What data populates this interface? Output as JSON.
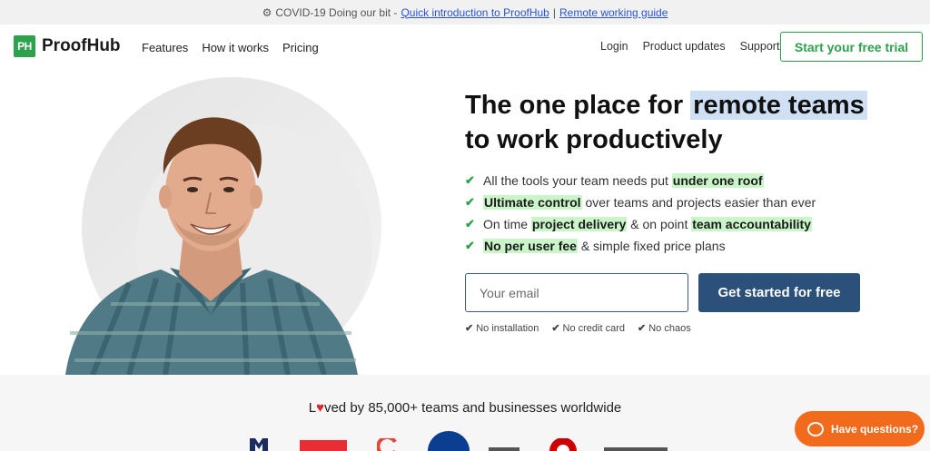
{
  "topbar": {
    "prefix": "COVID-19 Doing our bit -",
    "link1": "Quick introduction to ProofHub",
    "separator": "|",
    "link2": "Remote working guide"
  },
  "nav": {
    "logo_badge": "PH",
    "logo_text": "ProofHub",
    "left_items": [
      "Features",
      "How it works",
      "Pricing"
    ],
    "right_items": [
      "Login",
      "Product updates",
      "Support"
    ],
    "cta": "Start your free trial"
  },
  "hero": {
    "headline_part1": "The one place for",
    "headline_highlight": "remote teams",
    "headline_part2": "to work productively",
    "features": [
      {
        "before": "All the tools your team needs put ",
        "highlight": "under one roof",
        "after": ""
      },
      {
        "before": "",
        "highlight": "Ultimate control",
        "after": " over teams and projects easier than ever"
      },
      {
        "before": "On time ",
        "highlight": "project delivery",
        "middle": " & on point ",
        "highlight2": "team accountability",
        "after": ""
      },
      {
        "before": "",
        "highlight": "No per user fee",
        "after": " & simple fixed price plans"
      }
    ],
    "email_placeholder": "Your email",
    "cta_button": "Get started for free",
    "notes": [
      "No installation",
      "No credit card",
      "No chaos"
    ]
  },
  "loved": {
    "text_pre": "L",
    "text_post": "ved by 85,000+ teams and businesses worldwide"
  },
  "chat": {
    "label": "Have questions?"
  },
  "colors": {
    "brand_green": "#2ca24c",
    "cta_navy": "#2b5079",
    "chat_orange": "#f26b1d",
    "highlight_blue": "#cfe0f5",
    "highlight_green": "#c9f5c9"
  }
}
